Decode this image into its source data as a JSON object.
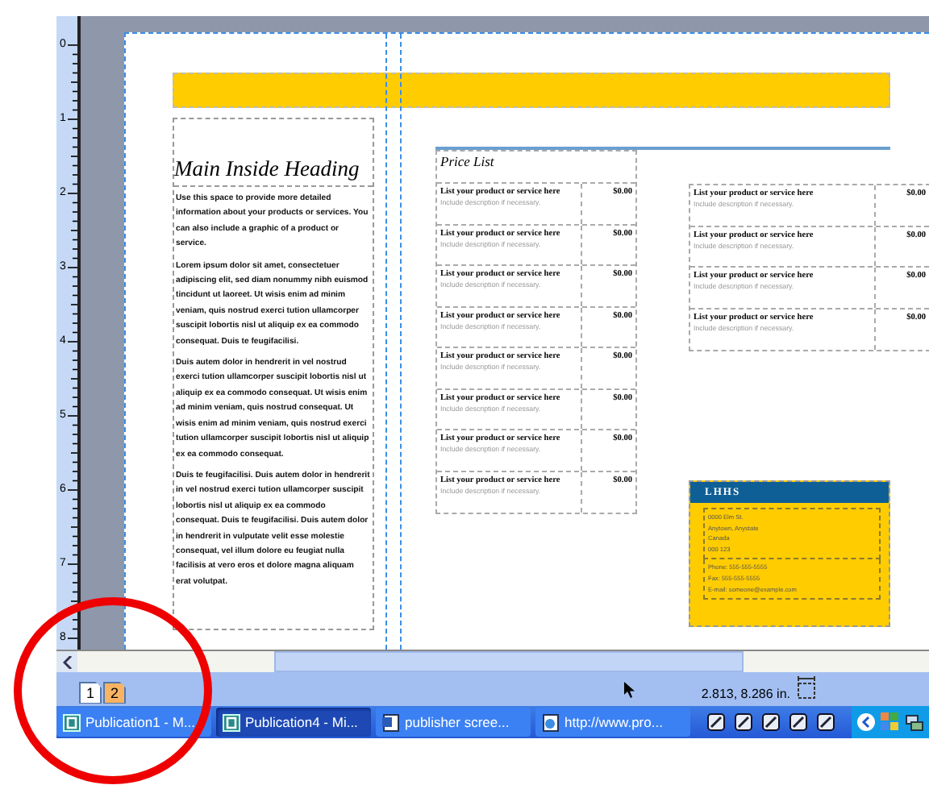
{
  "ruler": {
    "marks": [
      "0",
      "1",
      "2",
      "3",
      "4",
      "5",
      "6",
      "7",
      "8"
    ]
  },
  "main_column": {
    "heading": "Main Inside Heading",
    "paragraphs": [
      "Use this space to provide more detailed information about your products or services. You can also include a graphic of a product or service.",
      "Lorem ipsum dolor sit amet, consectetuer adipiscing elit, sed diam nonummy nibh euismod tincidunt ut laoreet. Ut wisis enim ad minim veniam, quis nostrud exerci tution ullamcorper suscipit lobortis nisl ut aliquip ex ea commodo consequat. Duis te feugifacilisi.",
      "Duis autem dolor in hendrerit in vel nostrud exerci tution ullamcorper suscipit lobortis nisl ut aliquip ex ea commodo consequat. Ut wisis enim ad minim veniam, quis nostrud consequat. Ut wisis enim ad minim veniam, quis nostrud exerci tution ullamcorper suscipit lobortis nisl ut aliquip ex ea commodo consequat.",
      "Duis te feugifacilisi. Duis autem dolor in hendrerit in vel nostrud exerci tution ullamcorper suscipit lobortis nisl ut aliquip ex ea commodo consequat. Duis te feugifacilisi. Duis autem dolor in hendrerit in vulputate velit esse molestie consequat, vel illum dolore eu feugiat nulla facilisis at vero eros et dolore magna aliquam erat volutpat."
    ]
  },
  "price_list": {
    "title": "Price List",
    "items": [
      {
        "name": "List your product or service here",
        "description": "Include description if necessary.",
        "price": "$0.00"
      },
      {
        "name": "List your product or service here",
        "description": "Include description if necessary.",
        "price": "$0.00"
      },
      {
        "name": "List your product or service here",
        "description": "Include description if necessary.",
        "price": "$0.00"
      },
      {
        "name": "List your product or service here",
        "description": "Include description if necessary.",
        "price": "$0.00"
      },
      {
        "name": "List your product or service here",
        "description": "Include description if necessary.",
        "price": "$0.00"
      },
      {
        "name": "List your product or service here",
        "description": "Include description if necessary.",
        "price": "$0.00"
      },
      {
        "name": "List your product or service here",
        "description": "Include description if necessary.",
        "price": "$0.00"
      },
      {
        "name": "List your product or service here",
        "description": "Include description if necessary.",
        "price": "$0.00"
      }
    ]
  },
  "price_list_continued": {
    "items": [
      {
        "name": "List your product or service here",
        "description": "Include description if necessary.",
        "price": "$0.00"
      },
      {
        "name": "List your product or service here",
        "description": "Include description if necessary.",
        "price": "$0.00"
      },
      {
        "name": "List your product or service here",
        "description": "Include description if necessary.",
        "price": "$0.00"
      },
      {
        "name": "List your product or service here",
        "description": "Include description if necessary.",
        "price": "$0.00"
      }
    ]
  },
  "contact_card": {
    "title": "LHHS",
    "address_lines": [
      "0000 Elm St.",
      "Anytown, Anystate",
      "Canada",
      "000 123"
    ],
    "contact_lines": [
      "Phone: 555-555-5555",
      "Fax: 555-555-5555",
      "E-mail: someone@example.com"
    ]
  },
  "status_bar": {
    "pages": [
      {
        "label": "1",
        "selected": false
      },
      {
        "label": "2",
        "selected": true
      }
    ],
    "position": "2.813, 8.286 in."
  },
  "taskbar": {
    "buttons": [
      {
        "kind": "publisher",
        "label": "Publication1 - M...",
        "selected": false
      },
      {
        "kind": "publisher",
        "label": "Publication4 - Mi...",
        "selected": true
      },
      {
        "kind": "document",
        "label": "publisher scree...",
        "selected": false
      },
      {
        "kind": "browser",
        "label": "http://www.pro...",
        "selected": false
      }
    ]
  }
}
